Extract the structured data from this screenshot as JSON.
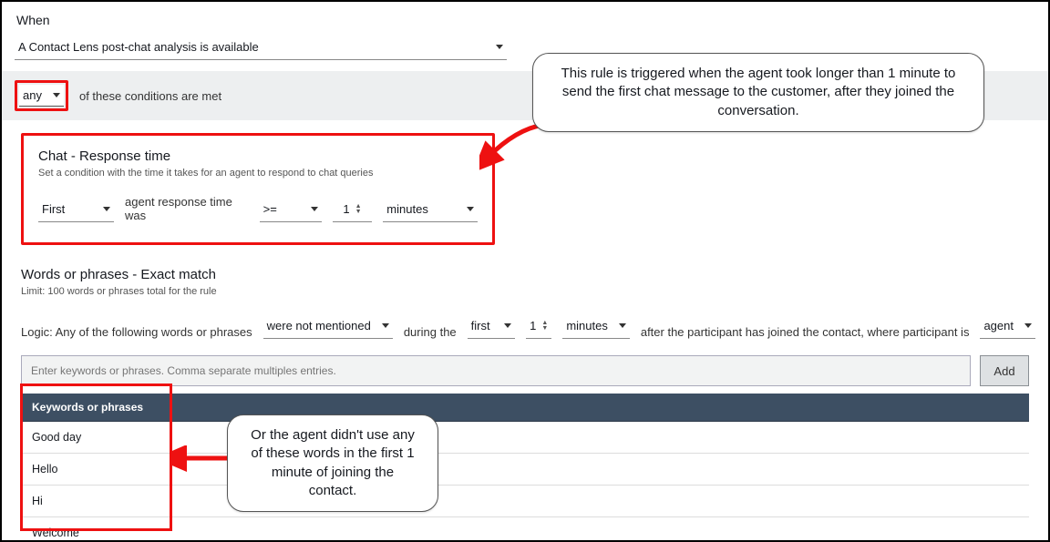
{
  "when_label": "When",
  "trigger": {
    "selected": "A Contact Lens post-chat analysis is available"
  },
  "match": {
    "quantifier": "any",
    "suffix": "of these conditions are met"
  },
  "chat": {
    "title": "Chat - Response time",
    "desc": "Set a condition with the time it takes for an agent to respond to chat queries",
    "position": "First",
    "mid": "agent response time was",
    "op": ">=",
    "value": "1",
    "unit": "minutes"
  },
  "words": {
    "title": "Words or phrases - Exact match",
    "desc": "Limit: 100 words or phrases total for the rule",
    "logic_prefix": "Logic: Any of the following words or phrases",
    "mentioned": "were not mentioned",
    "during_the": "during the",
    "when": "first",
    "value": "1",
    "unit": "minutes",
    "after_txt": "after the participant has joined the contact, where participant is",
    "participant": "agent"
  },
  "kw_input": {
    "placeholder": "Enter keywords or phrases. Comma separate multiples entries.",
    "add_label": "Add"
  },
  "kw_table": {
    "header": "Keywords or phrases",
    "rows": [
      "Good day",
      "Hello",
      "Hi",
      "Welcome"
    ]
  },
  "callouts": {
    "c1": "This rule is triggered when the agent took longer than 1 minute to send the first chat message to the customer, after they joined the conversation.",
    "c2": "Or the agent didn't use any of these words in the first 1 minute of joining the contact."
  }
}
